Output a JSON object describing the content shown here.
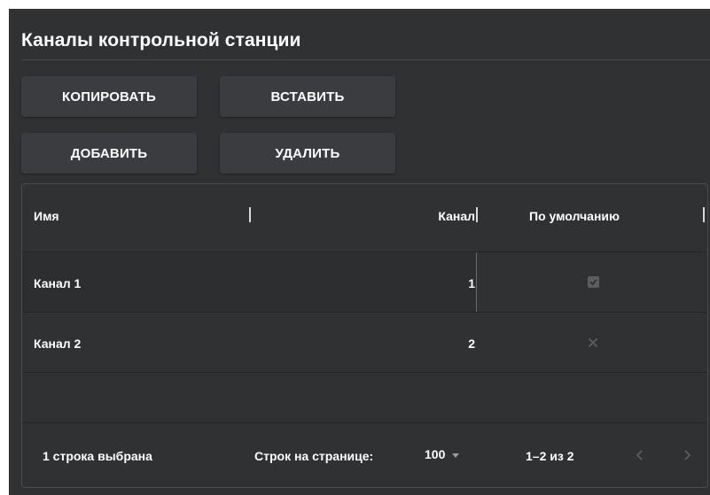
{
  "header": {
    "title": "Каналы контрольной станции"
  },
  "toolbar": {
    "copy_label": "КОПИРОВАТЬ",
    "paste_label": "ВСТАВИТЬ",
    "add_label": "ДОБАВИТЬ",
    "delete_label": "УДАЛИТЬ"
  },
  "grid": {
    "columns": {
      "name": "Имя",
      "channel": "Канал",
      "default": "По умолчанию"
    },
    "rows": [
      {
        "name": "Канал 1",
        "channel": "1",
        "default": true,
        "default_icon": "checkbox-checked-icon"
      },
      {
        "name": "Канал 2",
        "channel": "2",
        "default": false,
        "default_icon": "close-icon"
      }
    ]
  },
  "footer": {
    "selected_text": "1 строка выбрана",
    "rows_per_page_label": "Строк на странице:",
    "rows_per_page_value": "100",
    "range_text": "1–2 из 2",
    "prev_icon": "chevron-left-icon",
    "next_icon": "chevron-right-icon"
  },
  "colors": {
    "panel_bg": "#303133",
    "button_bg": "#3b3c3f",
    "text": "#ffffff",
    "muted_icon": "#5f6063"
  }
}
